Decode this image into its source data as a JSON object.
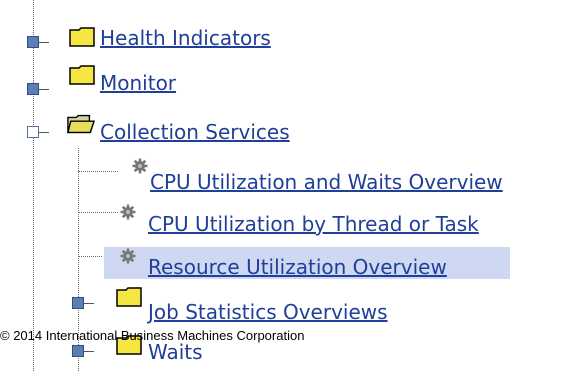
{
  "tree": {
    "items": [
      {
        "label": "Health Indicators",
        "state": "collapsed",
        "icon": "folder-icon"
      },
      {
        "label": "Monitor",
        "state": "collapsed",
        "icon": "folder-icon"
      },
      {
        "label": "Collection Services",
        "state": "expanded",
        "icon": "open-folder-icon",
        "children": [
          {
            "label": "CPU Utilization and Waits Overview",
            "icon": "gear-icon"
          },
          {
            "label": "CPU Utilization by Thread or Task",
            "icon": "gear-icon"
          },
          {
            "label": "Resource Utilization Overview",
            "icon": "gear-icon",
            "selected": true
          },
          {
            "label": "Job Statistics Overviews",
            "state": "collapsed",
            "icon": "folder-icon"
          },
          {
            "label": "Waits",
            "state": "collapsed",
            "icon": "folder-icon"
          }
        ]
      }
    ]
  },
  "footer": {
    "copyright": "© 2014 International Business Machines Corporation"
  },
  "colors": {
    "link": "#1f3f99",
    "selected_bg": "#cfd8f3",
    "expander_fill": "#5b7fb3",
    "folder_yellow": "#f5e642"
  }
}
